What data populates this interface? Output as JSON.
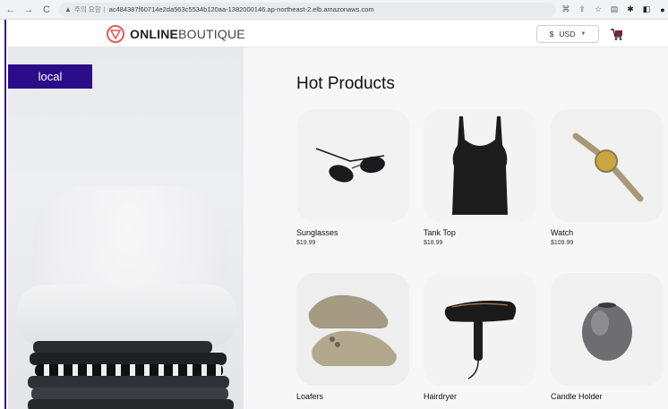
{
  "browser": {
    "url_warning": "주의 요함",
    "url": "ac484387f60714e2da563c5534b120aa-1382000146.ap-northeast-2.elb.amazonaws.com",
    "nav_back": "←",
    "nav_forward": "→",
    "nav_reload": "C"
  },
  "header": {
    "logo_bold": "ONLINE",
    "logo_light": "BOUTIQUE",
    "currency_symbol": "$",
    "currency_code": "USD",
    "brand_color": "#e35b5b"
  },
  "hero": {
    "badge_label": "local",
    "badge_color": "#2b0d8a"
  },
  "main": {
    "title": "Hot Products",
    "products": [
      {
        "name": "Sunglasses",
        "price": "$19.99",
        "icon": "sunglasses-image"
      },
      {
        "name": "Tank Top",
        "price": "$18.99",
        "icon": "tank-top-image"
      },
      {
        "name": "Watch",
        "price": "$109.99",
        "icon": "watch-image"
      },
      {
        "name": "Loafers",
        "price": "",
        "icon": "loafers-image"
      },
      {
        "name": "Hairdryer",
        "price": "",
        "icon": "hairdryer-image"
      },
      {
        "name": "Candle Holder",
        "price": "",
        "icon": "candle-holder-image"
      }
    ]
  }
}
